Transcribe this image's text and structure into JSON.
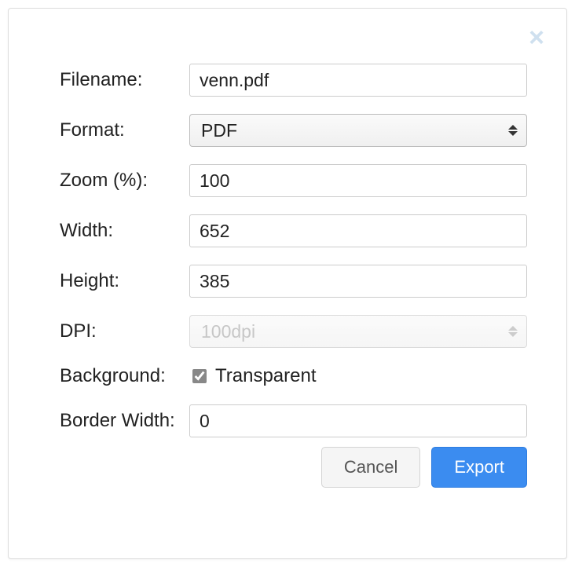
{
  "dialog": {
    "close_glyph": "×",
    "labels": {
      "filename": "Filename:",
      "format": "Format:",
      "zoom": "Zoom (%):",
      "width": "Width:",
      "height": "Height:",
      "dpi": "DPI:",
      "background": "Background:",
      "border_width": "Border Width:"
    },
    "values": {
      "filename": "venn.pdf",
      "format": "PDF",
      "zoom": "100",
      "width": "652",
      "height": "385",
      "dpi": "100dpi",
      "transparent_label": "Transparent",
      "border_width": "0"
    },
    "buttons": {
      "cancel": "Cancel",
      "export": "Export"
    }
  }
}
